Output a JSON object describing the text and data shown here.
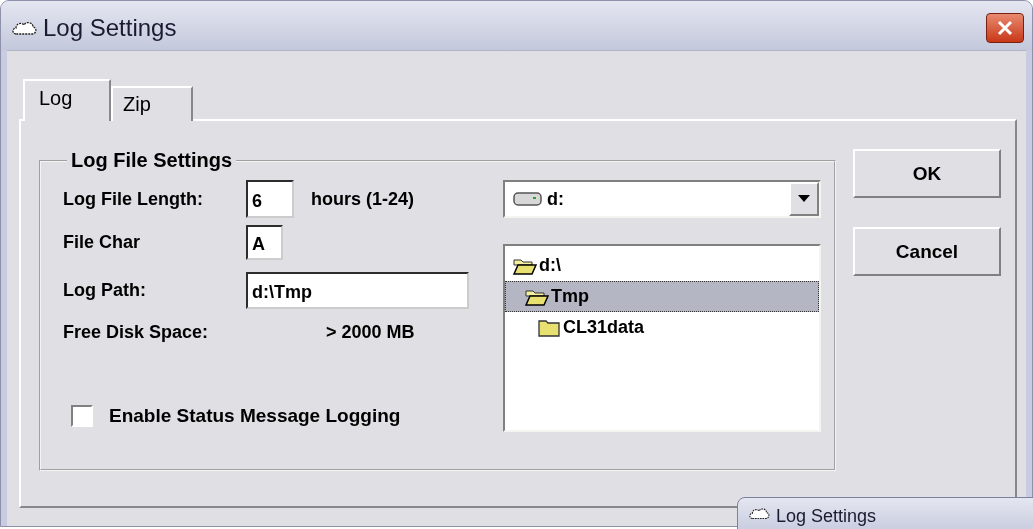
{
  "window": {
    "title": "Log Settings"
  },
  "tabs": [
    {
      "label": "Log",
      "selected": true
    },
    {
      "label": "Zip",
      "selected": false
    }
  ],
  "group": {
    "title": "Log File Settings"
  },
  "log_file_length": {
    "label": "Log File Length:",
    "value": "6",
    "unit": "hours (1-24)"
  },
  "file_char": {
    "label": "File Char",
    "value": "A"
  },
  "log_path": {
    "label": "Log Path:",
    "value": "d:\\Tmp"
  },
  "free_disk_space": {
    "label": "Free Disk Space:",
    "value": "> 2000 MB"
  },
  "status_logging": {
    "label": "Enable Status Message Logging",
    "checked": false
  },
  "drive": {
    "value": "d:"
  },
  "folders": [
    {
      "label": "d:\\",
      "expanded": true,
      "selected": false,
      "children": [
        {
          "label": "Tmp",
          "expanded": true,
          "selected": true,
          "children": [
            {
              "label": "CL31data",
              "expanded": false,
              "selected": false
            }
          ]
        }
      ]
    }
  ],
  "buttons": [
    {
      "label": "OK"
    },
    {
      "label": "Cancel"
    }
  ],
  "background_window": {
    "title": "Log Settings"
  }
}
